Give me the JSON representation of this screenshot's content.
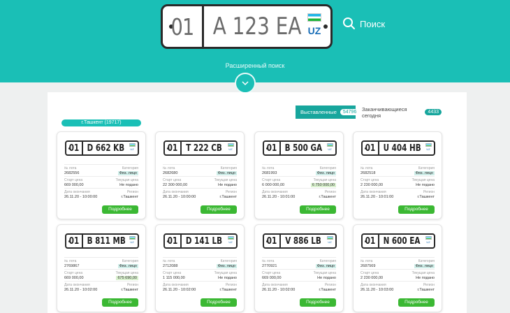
{
  "hero": {
    "plate_code": "01",
    "plate_number": "A 123 EA",
    "country": "UZ",
    "flag_icon": "uzbekistan-flag-icon",
    "accent": "#1abfb6"
  },
  "search": {
    "label": "Поиск",
    "icon": "search-icon"
  },
  "advanced_search": {
    "label": "Расширенный поиск",
    "icon": "chevron-down-icon"
  },
  "tabs": [
    {
      "label": "Выставленные",
      "count": "54796",
      "active": true
    },
    {
      "label": "Заканчивающиеся сегодня",
      "count": "4433",
      "active": false
    }
  ],
  "city_filter": "г.Ташкент (19717)",
  "field_labels": {
    "lot": "№ лота",
    "category": "Категория",
    "start_price": "Старт цена",
    "current_price": "Текущая цена",
    "end_date": "Дата окончания",
    "region": "Регион",
    "more_button": "Подробнее"
  },
  "cards": [
    {
      "code": "01",
      "number": "D 662 KB",
      "country": "UZ",
      "lot": "2682556",
      "category": "Физ. лицо",
      "start_price": "669 000,00",
      "current_price": "Не подано",
      "end_date": "26.11.20 - 10:00:00",
      "region": "г.Ташкент"
    },
    {
      "code": "01",
      "number": "T 222 CB",
      "country": "UZ",
      "lot": "2682680",
      "category": "Физ. лицо",
      "start_price": "22 300 000,00",
      "current_price": "Не подано",
      "end_date": "26.11.20 - 10:00:00",
      "region": "г.Ташкент"
    },
    {
      "code": "01",
      "number": "B 500 GA",
      "country": "UZ",
      "lot": "2681993",
      "category": "Физ. лицо",
      "start_price": "6 000 000,00",
      "current_price": "6 750 000,00",
      "current_price_highlight": true,
      "end_date": "26.11.20 - 10:01:00",
      "region": "г.Ташкент"
    },
    {
      "code": "01",
      "number": "U 404 HB",
      "country": "UZ",
      "lot": "2682518",
      "category": "Физ. лицо",
      "start_price": "2 230 000,00",
      "current_price": "Не подано",
      "end_date": "26.11.20 - 10:01:00",
      "region": "г.Ташкент"
    },
    {
      "code": "01",
      "number": "B 811 MB",
      "country": "UZ",
      "lot": "2769867",
      "category": "Физ. лицо",
      "start_price": "669 000,00",
      "current_price": "675 690,00",
      "current_price_highlight": true,
      "end_date": "26.11.20 - 10:02:00",
      "region": "г.Ташкент"
    },
    {
      "code": "01",
      "number": "D 141 LB",
      "country": "UZ",
      "lot": "2712088",
      "category": "Физ. лицо",
      "start_price": "1 115 000,00",
      "current_price": "Не подано",
      "end_date": "26.11.20 - 10:02:00",
      "region": "г.Ташкент"
    },
    {
      "code": "01",
      "number": "V 886 LB",
      "country": "UZ",
      "lot": "2770921",
      "category": "Физ. лицо",
      "start_price": "669 000,00",
      "current_price": "Не подано",
      "end_date": "26.11.20 - 10:02:00",
      "region": "г.Ташкент"
    },
    {
      "code": "01",
      "number": "N 600 EA",
      "country": "UZ",
      "lot": "2687569",
      "category": "Физ. лицо",
      "start_price": "2 230 000,00",
      "current_price": "Не подано",
      "end_date": "26.11.20 - 10:03:00",
      "region": "г.Ташкент"
    }
  ]
}
